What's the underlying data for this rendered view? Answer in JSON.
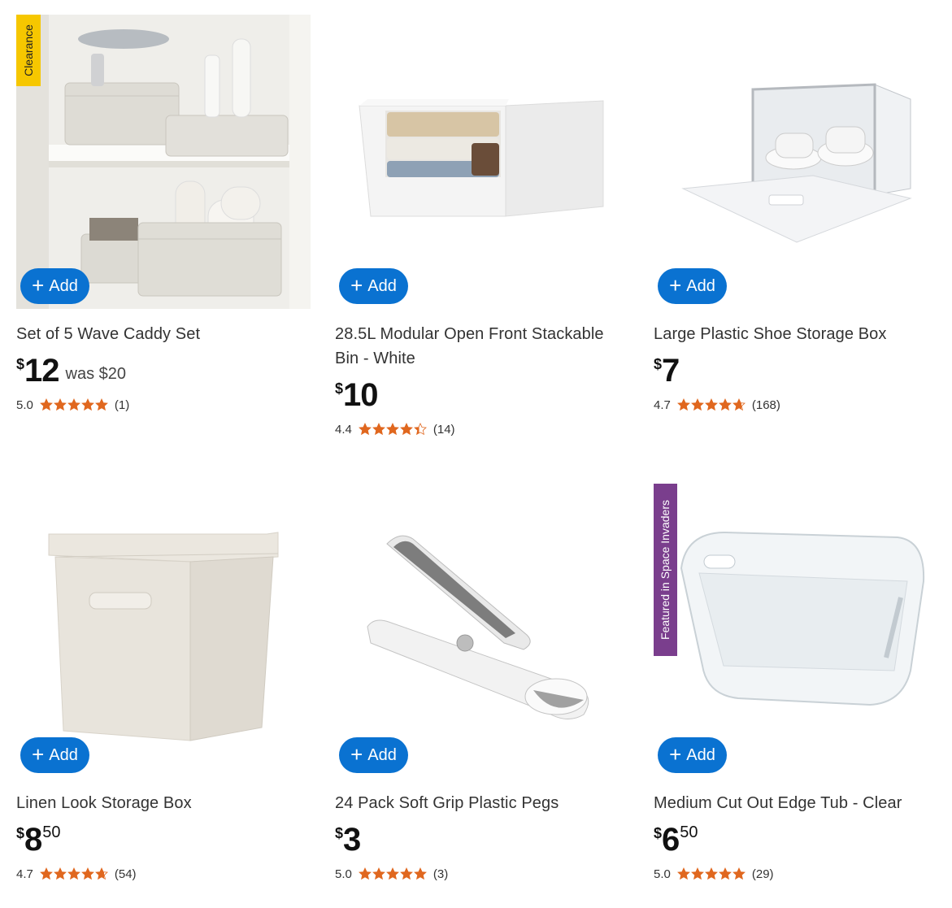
{
  "add_label": "Add",
  "currency": "$",
  "colors": {
    "accent": "#0a72d1",
    "star": "#e0671e",
    "clearance": "#f6c700",
    "featured": "#7a3e8d"
  },
  "products": [
    {
      "title": "Set of 5 Wave Caddy Set",
      "price_dollars": "12",
      "price_cents": "",
      "was": "was $20",
      "rating": "5.0",
      "stars": 5,
      "reviews": "(1)",
      "badge": "Clearance"
    },
    {
      "title": "28.5L Modular Open Front Stackable Bin - White",
      "price_dollars": "10",
      "price_cents": "",
      "was": "",
      "rating": "4.4",
      "stars": 4.4,
      "reviews": "(14)",
      "badge": ""
    },
    {
      "title": "Large Plastic Shoe Storage Box",
      "price_dollars": "7",
      "price_cents": "",
      "was": "",
      "rating": "4.7",
      "stars": 4.7,
      "reviews": "(168)",
      "badge": ""
    },
    {
      "title": "Linen Look Storage Box",
      "price_dollars": "8",
      "price_cents": "50",
      "was": "",
      "rating": "4.7",
      "stars": 4.7,
      "reviews": "(54)",
      "badge": ""
    },
    {
      "title": "24 Pack Soft Grip Plastic Pegs",
      "price_dollars": "3",
      "price_cents": "",
      "was": "",
      "rating": "5.0",
      "stars": 5,
      "reviews": "(3)",
      "badge": ""
    },
    {
      "title": "Medium Cut Out Edge Tub - Clear",
      "price_dollars": "6",
      "price_cents": "50",
      "was": "",
      "rating": "5.0",
      "stars": 5,
      "reviews": "(29)",
      "badge": "Featured in Space Invaders"
    }
  ]
}
